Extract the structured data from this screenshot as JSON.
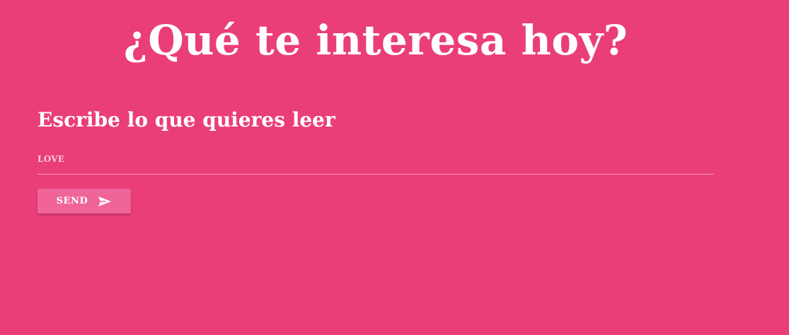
{
  "page": {
    "title": "¿Qué te interesa hoy?",
    "subtitle": "Escribe lo que quieres leer"
  },
  "search": {
    "value": "LOVE"
  },
  "actions": {
    "send_label": "SEND",
    "send_icon": "send-icon"
  },
  "colors": {
    "background": "#ea3e79",
    "button": "#f0649a",
    "text": "#ffffff"
  }
}
